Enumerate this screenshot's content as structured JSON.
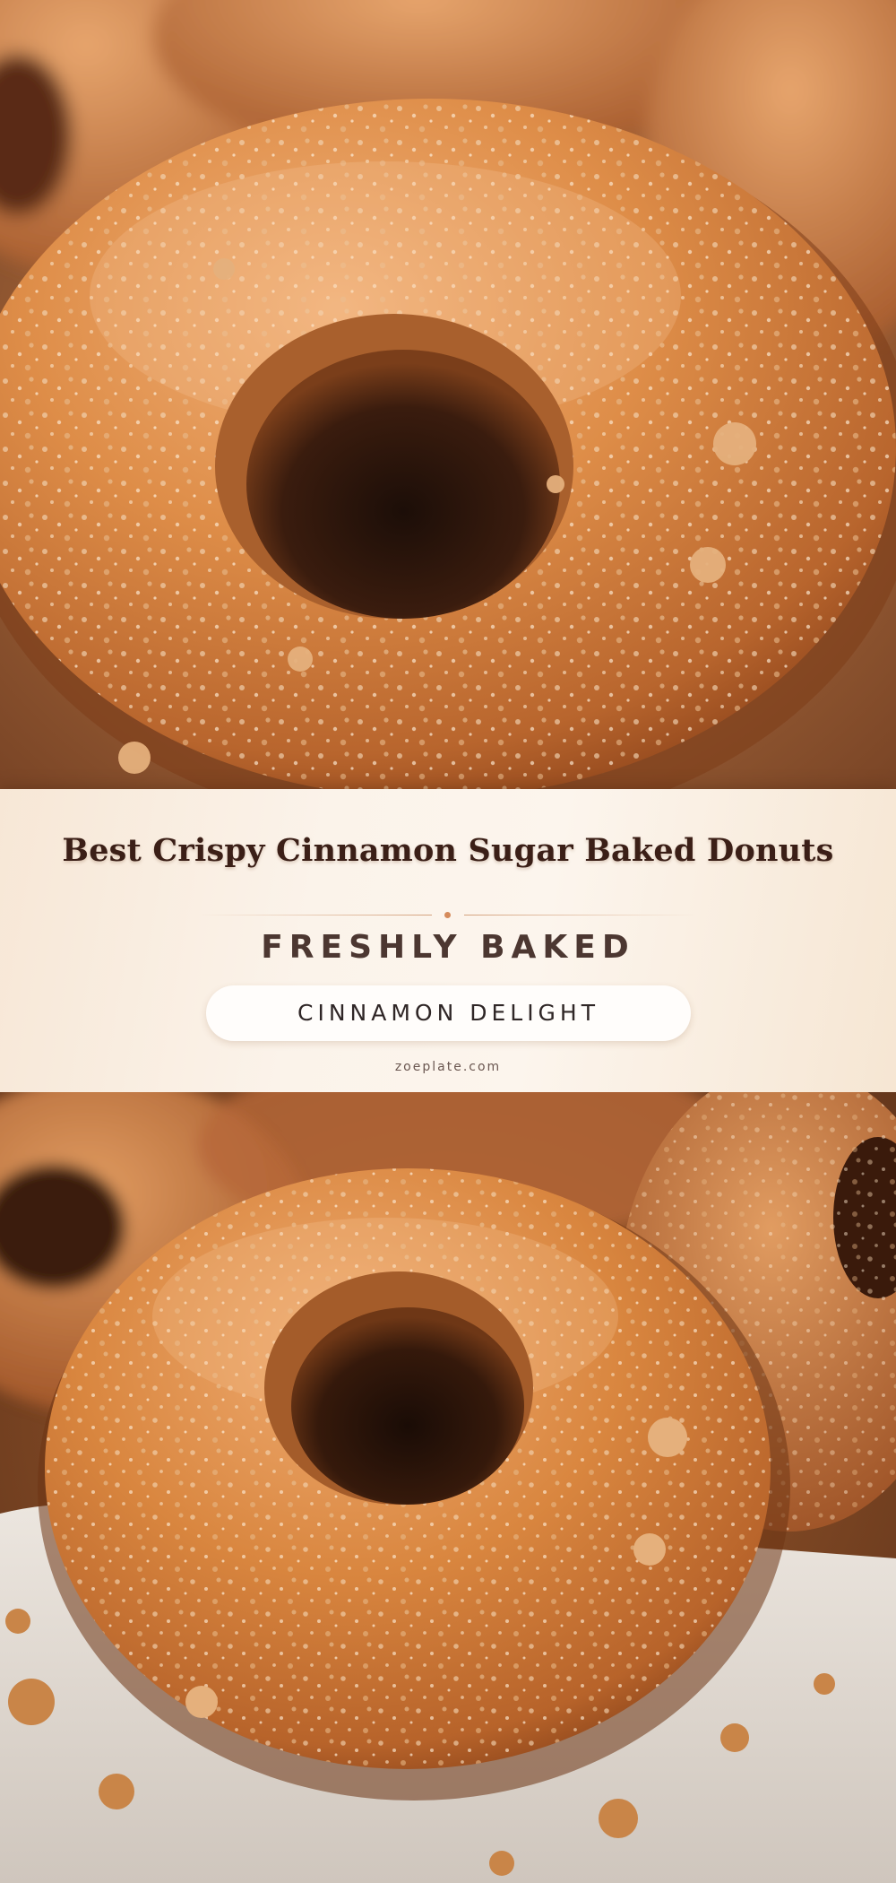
{
  "banner": {
    "title": "Best Crispy Cinnamon Sugar Baked Donuts",
    "subtitle": "FRESHLY BAKED",
    "tag": "CINNAMON DELIGHT",
    "site": "zoeplate.com"
  },
  "colors": {
    "banner_bg": "#fbf3ea",
    "title": "#3b1f17",
    "accent_dot": "#d58a5b",
    "donut_glaze": "#d98a45",
    "donut_dark": "#a85a25"
  },
  "photos": [
    {
      "name": "donut-photo-top"
    },
    {
      "name": "donut-photo-bottom"
    }
  ]
}
